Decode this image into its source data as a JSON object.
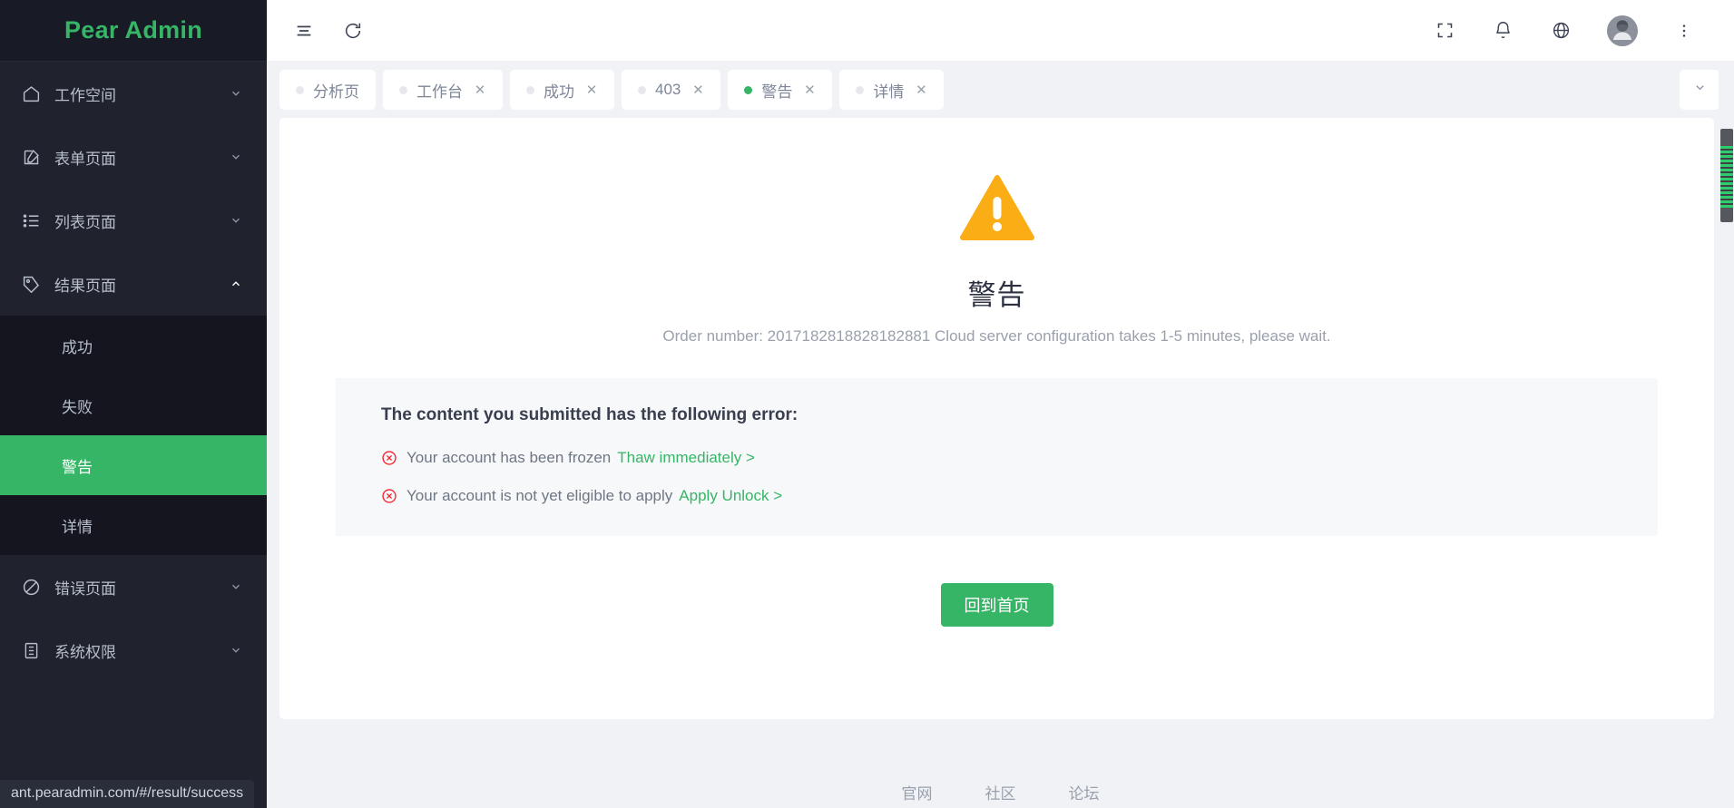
{
  "brand": {
    "title": "Pear Admin",
    "color": "#36b566"
  },
  "sidebar": {
    "items": [
      {
        "label": "工作空间",
        "icon": "home-icon",
        "arrow": "chevron-down-icon"
      },
      {
        "label": "表单页面",
        "icon": "edit-square-icon",
        "arrow": "chevron-down-icon"
      },
      {
        "label": "列表页面",
        "icon": "list-icon",
        "arrow": "chevron-down-icon"
      },
      {
        "label": "结果页面",
        "icon": "tag-icon",
        "arrow": "chevron-up-icon"
      },
      {
        "label": "错误页面",
        "icon": "ban-icon",
        "arrow": "chevron-down-icon"
      },
      {
        "label": "系统权限",
        "icon": "server-icon",
        "arrow": "chevron-down-icon"
      }
    ],
    "submenu": [
      {
        "label": "成功",
        "active": false
      },
      {
        "label": "失败",
        "active": false
      },
      {
        "label": "警告",
        "active": true
      },
      {
        "label": "详情",
        "active": false
      }
    ],
    "active_color": "#36b566"
  },
  "topbar": {
    "menu_toggle": "hamburger-icon",
    "refresh": "refresh-icon",
    "fullscreen": "fullscreen-icon",
    "notifications": "bell-icon",
    "language": "globe-icon",
    "avatar": "user-avatar",
    "more": "more-vertical-icon"
  },
  "tabs": {
    "items": [
      {
        "label": "分析页",
        "active": false,
        "closable": false
      },
      {
        "label": "工作台",
        "active": false,
        "closable": true
      },
      {
        "label": "成功",
        "active": false,
        "closable": true
      },
      {
        "label": "403",
        "active": false,
        "closable": true
      },
      {
        "label": "警告",
        "active": true,
        "closable": true
      },
      {
        "label": "详情",
        "active": false,
        "closable": true
      }
    ],
    "close_glyph": "✕",
    "dropdown_icon": "chevron-down-icon"
  },
  "result": {
    "status_icon": "warning-triangle-icon",
    "status_color": "#faad14",
    "title": "警告",
    "subtitle": "Order number: 2017182818828182881 Cloud server configuration takes 1-5 minutes, please wait.",
    "error_panel": {
      "heading": "The content you submitted has the following error:",
      "rows": [
        {
          "icon": "error-circle-icon",
          "text": "Your account has been frozen",
          "link": "Thaw immediately >"
        },
        {
          "icon": "error-circle-icon",
          "text": "Your account is not yet eligible to apply",
          "link": "Apply Unlock >"
        }
      ],
      "icon_color": "#f5222d",
      "link_color": "#36b566"
    },
    "primary_button": "回到首页"
  },
  "footer": {
    "links": [
      "官网",
      "社区",
      "论坛"
    ]
  },
  "status_bar": {
    "url": "ant.pearadmin.com/#/result/success"
  },
  "scrollbar": {
    "orientation": "vertical"
  }
}
